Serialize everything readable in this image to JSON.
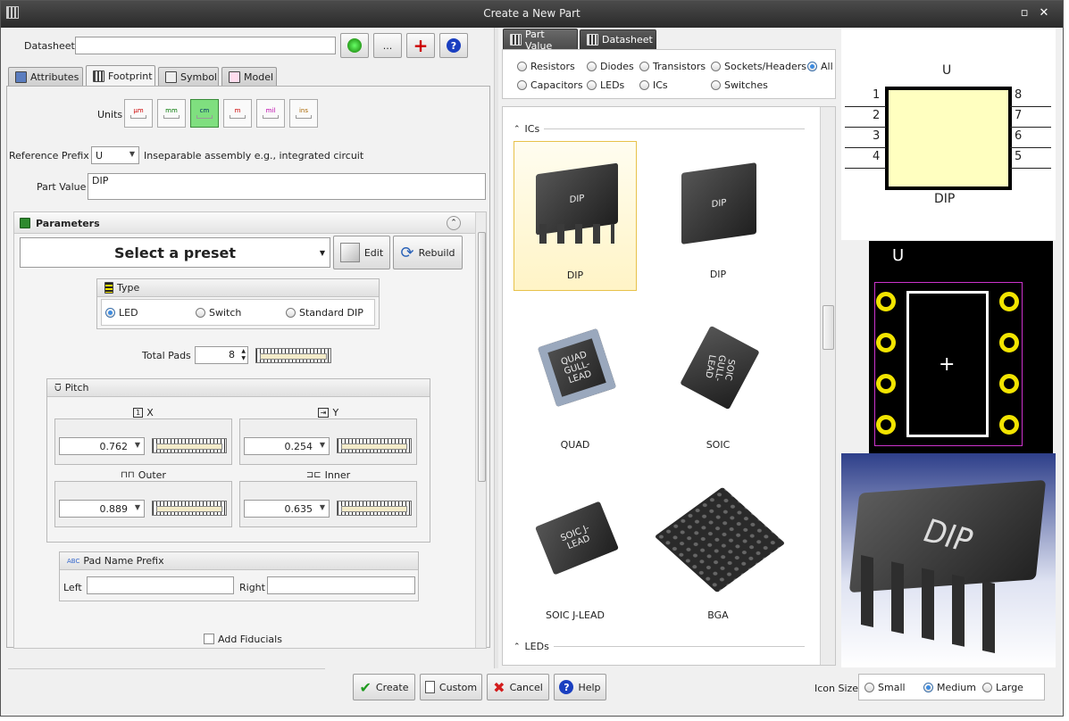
{
  "window": {
    "title": "Create a New Part"
  },
  "datasheet": {
    "label": "Datasheet",
    "value": "",
    "browse_label": "..."
  },
  "left_tabs": [
    {
      "label": "Attributes",
      "icon": "attributes-icon"
    },
    {
      "label": "Footprint",
      "icon": "footprint-icon",
      "selected": true
    },
    {
      "label": "Symbol",
      "icon": "symbol-icon"
    },
    {
      "label": "Model",
      "icon": "model-icon"
    }
  ],
  "units": {
    "label": "Units",
    "items": [
      "µm",
      "mm",
      "cm",
      "m",
      "mil",
      "ins"
    ],
    "selected": "cm"
  },
  "reference_prefix": {
    "label": "Reference Prefix",
    "value": "U",
    "description": "Inseparable assembly e.g., integrated circuit"
  },
  "part_value": {
    "label": "Part Value",
    "value": "DIP"
  },
  "parameters": {
    "title": "Parameters",
    "preset": "Select a preset",
    "edit_label": "Edit",
    "rebuild_label": "Rebuild",
    "type": {
      "title": "Type",
      "options": [
        "LED",
        "Switch",
        "Standard DIP"
      ],
      "selected": "LED"
    },
    "total_pads": {
      "label": "Total Pads",
      "value": "8"
    },
    "pitch": {
      "title": "Pitch",
      "x_label": "X",
      "x_value": "0.762",
      "y_label": "Y",
      "y_value": "0.254",
      "outer_label": "Outer",
      "outer_value": "0.889",
      "inner_label": "Inner",
      "inner_value": "0.635"
    },
    "pad_name_prefix": {
      "title": "Pad Name Prefix",
      "left_label": "Left",
      "left_value": "",
      "right_label": "Right",
      "right_value": ""
    },
    "add_fiducials": "Add Fiducials"
  },
  "right_tabs": [
    {
      "label": "Part Value",
      "selected": true
    },
    {
      "label": "Datasheet"
    }
  ],
  "filters": {
    "row1": [
      "Resistors",
      "Diodes",
      "Transistors",
      "Sockets/Headers",
      "All"
    ],
    "row2": [
      "Capacitors",
      "LEDs",
      "ICs",
      "Switches"
    ],
    "selected": "All"
  },
  "gallery": {
    "sections": [
      "ICs",
      "LEDs"
    ],
    "items": [
      {
        "name": "DIP",
        "chip": "DIP",
        "selected": true
      },
      {
        "name": "DIP",
        "chip": "DIP"
      },
      {
        "name": "QUAD",
        "chip": "QUAD GULL-LEAD"
      },
      {
        "name": "SOIC",
        "chip": "SOIC GULL-LEAD"
      },
      {
        "name": "SOIC J-LEAD",
        "chip": "SOIC J-LEAD"
      },
      {
        "name": "BGA",
        "chip": ""
      }
    ]
  },
  "preview": {
    "symbol": {
      "ref": "U",
      "value": "DIP",
      "left_pins": [
        "1",
        "2",
        "3",
        "4"
      ],
      "right_pins": [
        "8",
        "7",
        "6",
        "5"
      ]
    },
    "footprint_ref": "U",
    "model_label": "DIP"
  },
  "buttons": {
    "create": "Create",
    "custom": "Custom",
    "cancel": "Cancel",
    "help": "Help"
  },
  "icon_size": {
    "label": "Icon Size",
    "options": [
      "Small",
      "Medium",
      "Large"
    ],
    "selected": "Medium"
  },
  "colors": {
    "accent": "#3d8be0",
    "symbol_fill": "#ffffc0",
    "pad": "#f2e400",
    "outline": "#cc33cc"
  }
}
